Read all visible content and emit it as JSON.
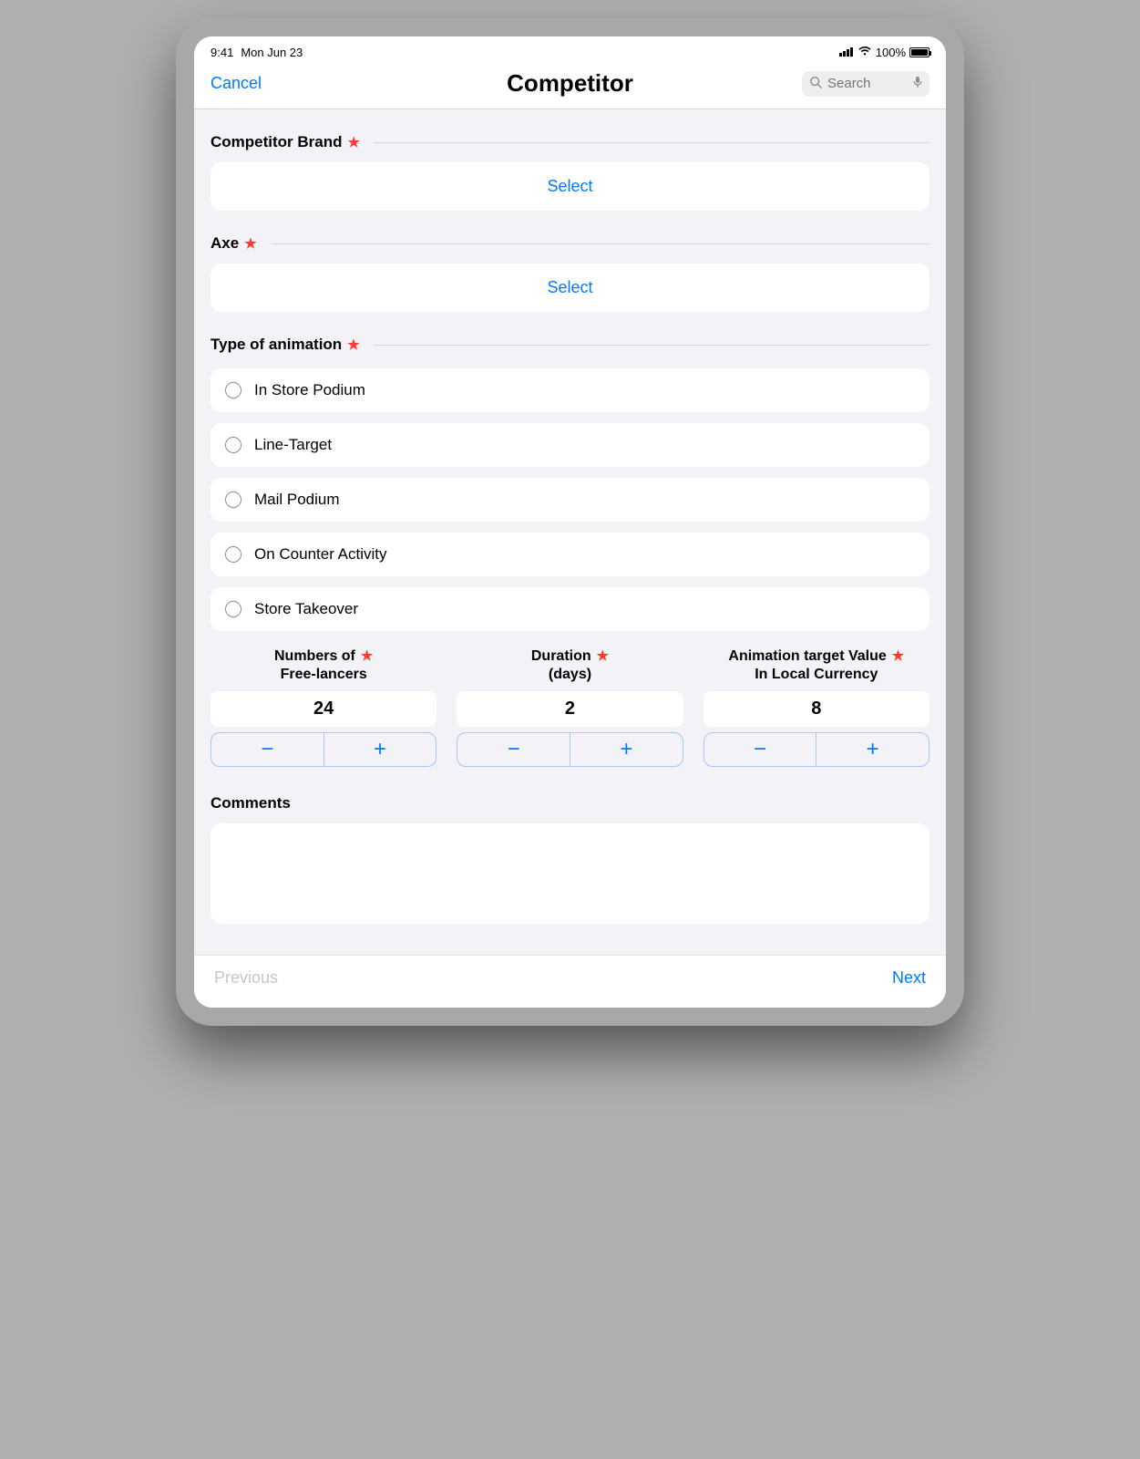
{
  "status": {
    "time": "9:41",
    "date": "Mon Jun 23",
    "battery_pct": "100%"
  },
  "nav": {
    "cancel": "Cancel",
    "title": "Competitor",
    "search_placeholder": "Search"
  },
  "form": {
    "competitor_brand": {
      "title": "Competitor Brand",
      "button": "Select"
    },
    "axe": {
      "title": "Axe",
      "button": "Select"
    },
    "animation_type": {
      "title": "Type of animation",
      "options": [
        "In Store Podium",
        "Line-Target",
        "Mail Podium",
        "On Counter Activity",
        "Store Takeover"
      ]
    },
    "steppers": {
      "freelancers": {
        "line1": "Numbers of",
        "line2": "Free-lancers",
        "value": "24"
      },
      "duration": {
        "line1": "Duration",
        "line2": "(days)",
        "value": "2"
      },
      "target": {
        "line1": "Animation target Value",
        "line2": "In Local Currency",
        "value": "8"
      }
    },
    "comments_title": "Comments"
  },
  "footer": {
    "prev": "Previous",
    "next": "Next"
  }
}
